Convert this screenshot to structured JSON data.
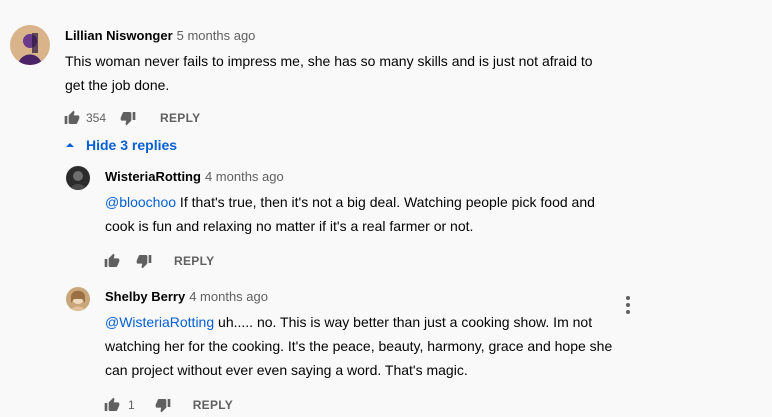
{
  "comment_main": {
    "author": "Lillian Niswonger",
    "time": "5 months ago",
    "text": "This woman never fails to impress me, she has so many skills and is just not afraid to get the job done.",
    "likes": "354",
    "reply_label": "REPLY",
    "like_icon": "thumb-up-icon",
    "dislike_icon": "thumb-down-icon"
  },
  "replies_toggle": {
    "label": "Hide 3 replies",
    "icon": "chevron-up-icon"
  },
  "reply_1": {
    "author": "WisteriaRotting",
    "time": "4 months ago",
    "mention": "@bloochoo",
    "text": " If that's true, then it's not a big deal. Watching people pick food and cook is fun and relaxing no matter if it's a real farmer or not.",
    "reply_label": "REPLY"
  },
  "reply_2": {
    "author": "Shelby Berry",
    "time": "4 months ago",
    "mention": "@WisteriaRotting",
    "text": " uh..... no. This is way better than just a cooking show. Im not watching her for the cooking. It's the peace, beauty, harmony, grace and hope she can project without ever even saying a word. That's magic.",
    "likes": "1",
    "reply_label": "REPLY",
    "menu_icon": "more-vert-icon"
  },
  "colors": {
    "link_blue": "#065fd4",
    "secondary_text": "#606060",
    "background": "#f9f9f9"
  }
}
